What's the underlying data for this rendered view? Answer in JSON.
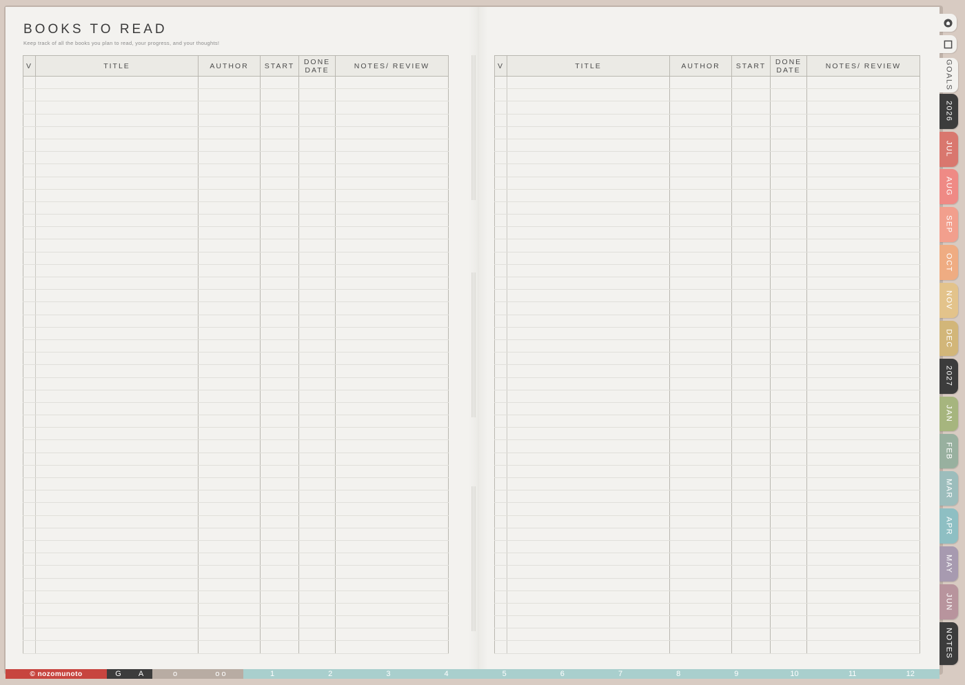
{
  "page": {
    "title": "BOOKS TO READ",
    "subtitle": "Keep track of all the books you plan to read, your progress, and your thoughts!"
  },
  "table": {
    "columns": [
      "V",
      "TITLE",
      "AUTHOR",
      "START",
      "DONE DATE",
      "NOTES/ REVIEW"
    ],
    "row_count": 46
  },
  "tabs": [
    {
      "label": "GOALS",
      "color": "#f3f2ef",
      "text_color": "#555555"
    },
    {
      "label": "2026",
      "color": "#3c3c3c",
      "text_color": "#ffffff"
    },
    {
      "label": "JUL",
      "color": "#d9776e",
      "text_color": "#ffffff"
    },
    {
      "label": "AUG",
      "color": "#ef8a85",
      "text_color": "#ffffff"
    },
    {
      "label": "SEP",
      "color": "#f29f8d",
      "text_color": "#ffffff"
    },
    {
      "label": "OCT",
      "color": "#efac82",
      "text_color": "#ffffff"
    },
    {
      "label": "NOV",
      "color": "#e3c38b",
      "text_color": "#ffffff"
    },
    {
      "label": "DEC",
      "color": "#d2b679",
      "text_color": "#ffffff"
    },
    {
      "label": "2027",
      "color": "#3c3c3c",
      "text_color": "#ffffff"
    },
    {
      "label": "JAN",
      "color": "#a6b57e",
      "text_color": "#ffffff"
    },
    {
      "label": "FEB",
      "color": "#98b09f",
      "text_color": "#ffffff"
    },
    {
      "label": "MAR",
      "color": "#9cbdbc",
      "text_color": "#ffffff"
    },
    {
      "label": "APR",
      "color": "#8ebfc3",
      "text_color": "#ffffff"
    },
    {
      "label": "MAY",
      "color": "#a79ab0",
      "text_color": "#ffffff"
    },
    {
      "label": "JUN",
      "color": "#b8949d",
      "text_color": "#ffffff"
    },
    {
      "label": "NOTES",
      "color": "#3c3c3c",
      "text_color": "#ffffff"
    }
  ],
  "icon_tabs": [
    {
      "icon": "home-icon"
    },
    {
      "icon": "square-icon"
    }
  ],
  "bottom_bar": {
    "brand": "© nozomunoto",
    "letters": [
      "G",
      "A"
    ],
    "dots": [
      "o",
      "o o"
    ],
    "months": [
      "1",
      "2",
      "3",
      "4",
      "5",
      "6",
      "7",
      "8",
      "9",
      "10",
      "11",
      "12"
    ],
    "colors": {
      "brand": "#c7453f",
      "letters": "#3c3c3c",
      "dots": "#b8aca3",
      "months": "#a9cfcd"
    }
  }
}
